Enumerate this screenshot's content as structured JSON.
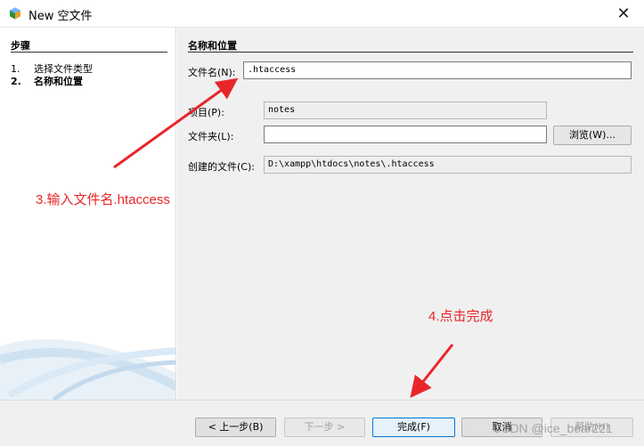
{
  "window": {
    "title": "New 空文件",
    "close_glyph": "✕",
    "icon": "netbeans-cube-icon"
  },
  "steps": {
    "heading": "步骤",
    "items": [
      {
        "num": "1.",
        "label": "选择文件类型"
      },
      {
        "num": "2.",
        "label": "名称和位置"
      }
    ]
  },
  "content": {
    "heading": "名称和位置",
    "file_name": {
      "label": "文件名(N):",
      "value": ".htaccess"
    },
    "project": {
      "label": "项目(P):",
      "value": "notes"
    },
    "folder": {
      "label": "文件夹(L):",
      "value": ""
    },
    "browse_label": "浏览(W)...",
    "created_file": {
      "label": "创建的文件(C):",
      "value": "D:\\xampp\\htdocs\\notes\\.htaccess"
    }
  },
  "buttons": {
    "back": "< 上一步(B)",
    "next": "下一步 >",
    "finish": "完成(F)",
    "cancel": "取消",
    "help": "帮助(H)"
  },
  "annotations": {
    "step3": "3.输入文件名.htaccess",
    "step4": "4.点击完成",
    "color": "#e8262a"
  },
  "watermark": "CSDN @ice_bear221"
}
